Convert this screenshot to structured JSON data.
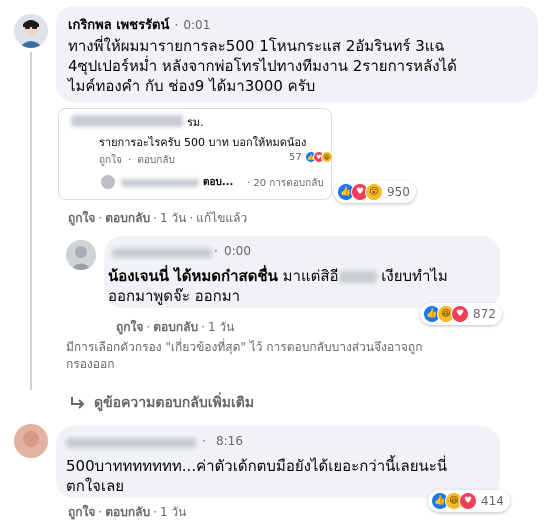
{
  "comment1": {
    "author": "เกริกพล เพชรรัตน์",
    "time": "0:01",
    "text_line1": "ทางพี่ให้ผมมารายการละ500 1โหนกระแส 2อัมรินทร์ 3แฉ",
    "text_line2": "4ซุปเปอร์หม่ำ หลังจากพ่อโทรไปทางทีมงาน 2รายการหลังได้",
    "text_line3": "ไมค์ทองคำ กับ ช่อง9 ได้มา3000 ครับ",
    "shared": {
      "author_suffix": "รม.",
      "text": "รายการอะไรครับ 500 บาท บอกให้หมดน้อง",
      "like": "ถูกใจ",
      "reply": "ตอบกลับ",
      "reaction_count": "57",
      "sub_reply": "ตอบ...",
      "sub_replies": "· 20 การตอบกลับ"
    },
    "reaction_count": "950",
    "actions": {
      "like": "ถูกใจ",
      "reply": "ตอบกลับ",
      "age": "1 วัน",
      "edited": "แก้ไขแล้ว"
    }
  },
  "comment2": {
    "time": "0:00",
    "text_bold": "น้องเจนนี่ ได้หมดก๋าสดชื่น",
    "text_rest": " มาแต่สิอี",
    "text_after": " เงียบทำไม",
    "text_line2": "ออกมาพูดจ๊ะ ออกมา",
    "reaction_count": "872",
    "actions": {
      "like": "ถูกใจ",
      "reply": "ตอบกลับ",
      "age": "1 วัน"
    }
  },
  "filter_notice_line1": "มีการเลือกตัวกรอง \"เกี่ยวข้องที่สุด\" ไว้ การตอบกลับบางส่วนจึงอาจถูก",
  "filter_notice_line2": "กรองออก",
  "more_replies": "ดูข้อความตอบกลับเพิ่มเติม",
  "comment3": {
    "time": "8:16",
    "text_line1": "500บาททททททท...ค่าตัวเด้กตบมือยังได้เยอะกว่านี้เลยนะนี่",
    "text_line2": "ตกใจเลย",
    "reaction_count": "414",
    "actions": {
      "like": "ถูกใจ",
      "reply": "ตอบกลับ",
      "age": "1 วัน"
    }
  },
  "icons": {
    "like": "like-reaction-icon",
    "love": "love-reaction-icon",
    "haha": "haha-reaction-icon",
    "wow": "wow-reaction-icon",
    "reply_arrow": "reply-arrow-icon"
  },
  "colors": {
    "like": "#1877f2",
    "love": "#f33e58",
    "haha": "#f7b928",
    "meta": "#65676b",
    "bubble": "#f0f2f5"
  }
}
